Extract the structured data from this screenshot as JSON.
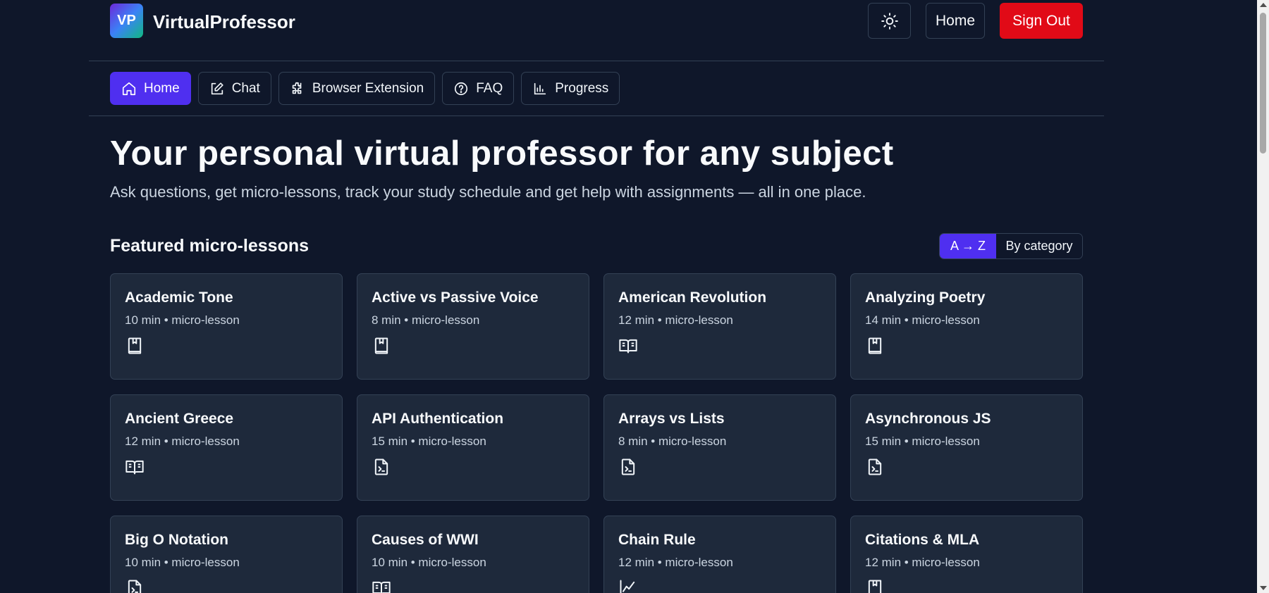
{
  "brand": {
    "badge": "VP",
    "name": "VirtualProfessor",
    "gradient": [
      "#6d28d9",
      "#3b82f6",
      "#10b981"
    ]
  },
  "header": {
    "theme_icon": "sun-icon",
    "home_label": "Home",
    "signout_label": "Sign Out",
    "signout_color": "#e10a17"
  },
  "nav": {
    "accent": "#4f2ff0",
    "items": [
      {
        "label": "Home",
        "icon": "home-icon",
        "active": true
      },
      {
        "label": "Chat",
        "icon": "edit-icon",
        "active": false
      },
      {
        "label": "Browser Extension",
        "icon": "puzzle-icon",
        "active": false
      },
      {
        "label": "FAQ",
        "icon": "help-circle-icon",
        "active": false
      },
      {
        "label": "Progress",
        "icon": "chart-icon",
        "active": false
      }
    ]
  },
  "hero": {
    "title": "Your personal virtual professor for any subject",
    "subtitle": "Ask questions, get micro-lessons, track your study schedule and get help with assignments — all in one place."
  },
  "lessons": {
    "title": "Featured micro-lessons",
    "sort_options": {
      "az": "A → Z",
      "category": "By category",
      "selected": "az"
    },
    "items": [
      {
        "title": "Academic Tone",
        "meta": "10 min • micro-lesson",
        "icon": "book-icon"
      },
      {
        "title": "Active vs Passive Voice",
        "meta": "8 min • micro-lesson",
        "icon": "book-icon"
      },
      {
        "title": "American Revolution",
        "meta": "12 min • micro-lesson",
        "icon": "book-open-icon"
      },
      {
        "title": "Analyzing Poetry",
        "meta": "14 min • micro-lesson",
        "icon": "book-icon"
      },
      {
        "title": "Ancient Greece",
        "meta": "12 min • micro-lesson",
        "icon": "book-open-icon"
      },
      {
        "title": "API Authentication",
        "meta": "15 min • micro-lesson",
        "icon": "file-code-icon"
      },
      {
        "title": "Arrays vs Lists",
        "meta": "8 min • micro-lesson",
        "icon": "file-code-icon"
      },
      {
        "title": "Asynchronous JS",
        "meta": "15 min • micro-lesson",
        "icon": "file-code-icon"
      },
      {
        "title": "Big O Notation",
        "meta": "10 min • micro-lesson",
        "icon": "file-code-icon"
      },
      {
        "title": "Causes of WWI",
        "meta": "10 min • micro-lesson",
        "icon": "book-open-icon"
      },
      {
        "title": "Chain Rule",
        "meta": "12 min • micro-lesson",
        "icon": "chart-line-icon"
      },
      {
        "title": "Citations & MLA",
        "meta": "12 min • micro-lesson",
        "icon": "book-icon"
      }
    ]
  }
}
